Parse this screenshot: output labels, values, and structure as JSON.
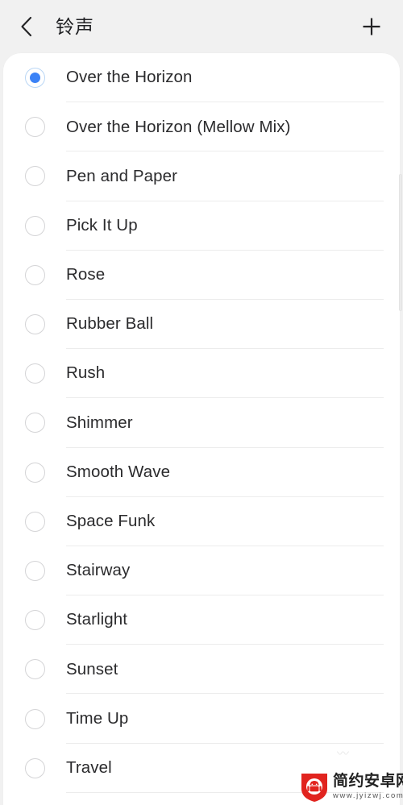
{
  "header": {
    "back_icon": "chevron-left-icon",
    "title": "铃声",
    "add_icon": "plus-icon"
  },
  "colors": {
    "page_background": "#f1f1f1",
    "card_background": "#ffffff",
    "accent_selected": "#3b82f6",
    "radio_border": "#d4d4d6",
    "separator": "#ececec",
    "text_primary": "#2b2b2d",
    "watermark_red": "#e1241f"
  },
  "ringtone_list": {
    "selected_index": 0,
    "items": [
      {
        "label": "Over the Horizon",
        "selected": true
      },
      {
        "label": "Over the Horizon (Mellow Mix)",
        "selected": false
      },
      {
        "label": "Pen and Paper",
        "selected": false
      },
      {
        "label": "Pick It Up",
        "selected": false
      },
      {
        "label": "Rose",
        "selected": false
      },
      {
        "label": "Rubber Ball",
        "selected": false
      },
      {
        "label": "Rush",
        "selected": false
      },
      {
        "label": "Shimmer",
        "selected": false
      },
      {
        "label": "Smooth Wave",
        "selected": false
      },
      {
        "label": "Space Funk",
        "selected": false
      },
      {
        "label": "Stairway",
        "selected": false
      },
      {
        "label": "Starlight",
        "selected": false
      },
      {
        "label": "Sunset",
        "selected": false
      },
      {
        "label": "Time Up",
        "selected": false
      },
      {
        "label": "Travel",
        "selected": false
      }
    ]
  },
  "watermark": {
    "site_name": "简约安卓网",
    "url": "www.jyizwj.com",
    "icon": "android-shield-icon"
  }
}
